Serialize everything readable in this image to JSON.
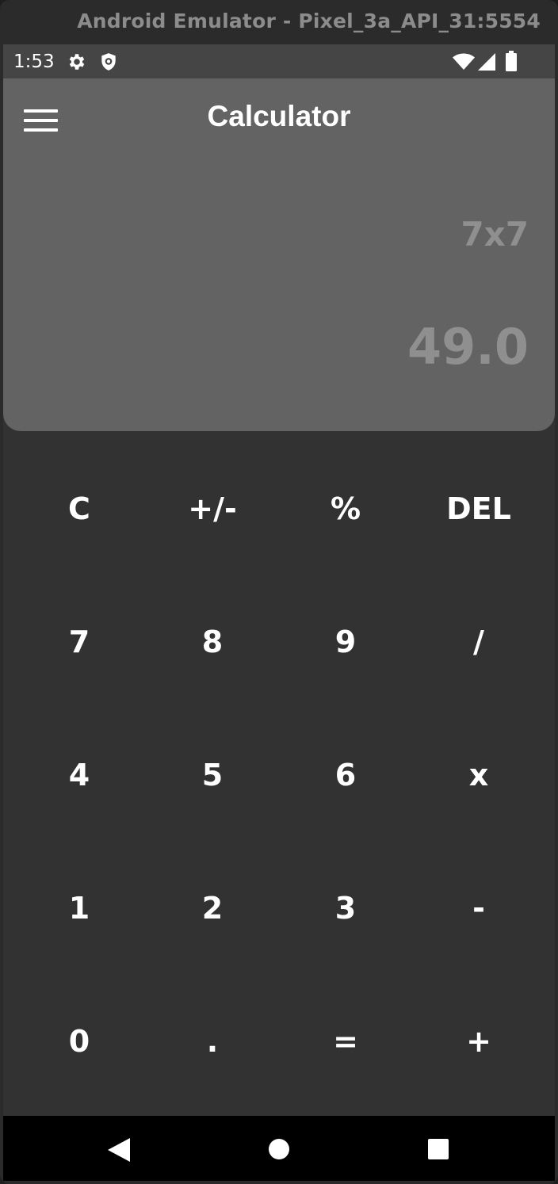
{
  "window": {
    "title": "Android Emulator - Pixel_3a_API_31:5554"
  },
  "status_bar": {
    "time": "1:53",
    "icons": [
      "settings-icon",
      "shield-icon",
      "wifi-icon",
      "signal-icon",
      "battery-icon"
    ]
  },
  "app": {
    "title": "Calculator",
    "menu_icon": "hamburger-menu-icon"
  },
  "display": {
    "expression": "7x7",
    "result": "49.0"
  },
  "keypad": {
    "rows": [
      [
        "C",
        "+/-",
        "%",
        "DEL"
      ],
      [
        "7",
        "8",
        "9",
        "/"
      ],
      [
        "4",
        "5",
        "6",
        "x"
      ],
      [
        "1",
        "2",
        "3",
        "-"
      ],
      [
        "0",
        ".",
        "=",
        "+"
      ]
    ]
  },
  "nav_bar": {
    "icons": [
      "back-icon",
      "home-icon",
      "recents-icon"
    ]
  },
  "colors": {
    "display_bg": "#636363",
    "keypad_bg": "#323232",
    "status_bar_bg": "#454545",
    "display_text": "#8f8f8f",
    "key_text": "#ffffff"
  }
}
